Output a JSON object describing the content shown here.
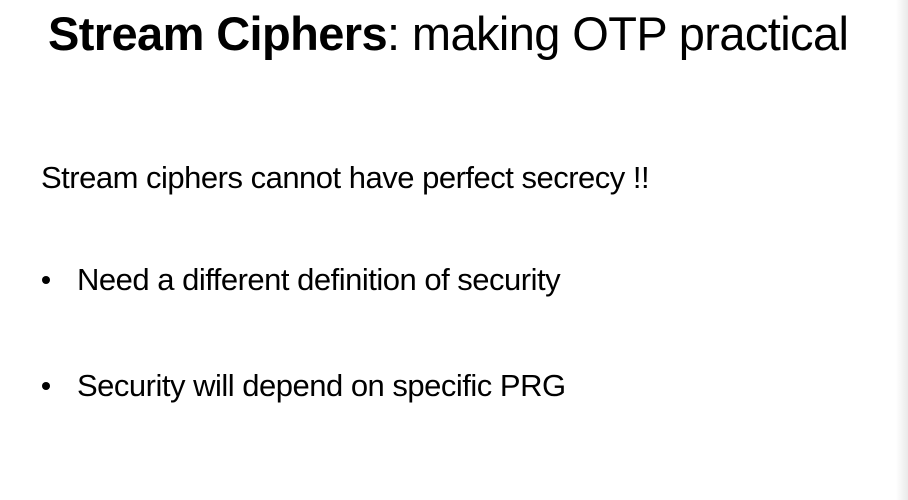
{
  "title": {
    "emphasis": "Stream Ciphers",
    "rest": ":  making OTP practical"
  },
  "statement": "Stream ciphers cannot have perfect secrecy  !!",
  "bullets": [
    {
      "text": "Need a different definition of security"
    },
    {
      "text": "Security will depend on specific PRG"
    }
  ],
  "colors": {
    "text": "#000000",
    "background": "#ffffff"
  }
}
